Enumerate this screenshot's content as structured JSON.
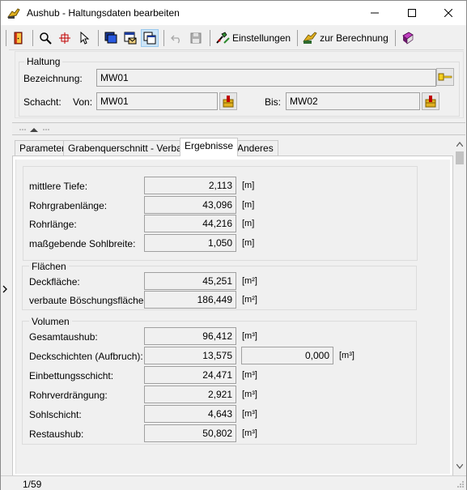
{
  "window": {
    "title": "Aushub - Haltungsdaten bearbeiten"
  },
  "toolbar": {
    "settings_label": "Einstellungen",
    "calculate_label": "zur Berechnung"
  },
  "haltung": {
    "group_title": "Haltung",
    "bezeichnung_label": "Bezeichnung:",
    "bezeichnung_value": "MW01",
    "schacht_label": "Schacht:",
    "von_label": "Von:",
    "von_value": "MW01",
    "bis_label": "Bis:",
    "bis_value": "MW02"
  },
  "tabs": [
    {
      "label": "Parameter"
    },
    {
      "label": "Grabenquerschnitt - Verbaut"
    },
    {
      "label": "Ergebnisse"
    },
    {
      "label": "Anderes"
    }
  ],
  "results": {
    "general": [
      {
        "label": "mittlere Tiefe:",
        "value": "2,113",
        "unit": "[m]"
      },
      {
        "label": "Rohrgrabenlänge:",
        "value": "43,096",
        "unit": "[m]"
      },
      {
        "label": "Rohrlänge:",
        "value": "44,216",
        "unit": "[m]"
      },
      {
        "label": "maßgebende Sohlbreite:",
        "value": "1,050",
        "unit": "[m]"
      }
    ],
    "flaechen": {
      "title": "Flächen",
      "rows": [
        {
          "label": "Deckfläche:",
          "value": "45,251",
          "unit": "[m²]"
        },
        {
          "label": "verbaute Böschungsfläche:",
          "value": "186,449",
          "unit": "[m²]"
        }
      ]
    },
    "volumen": {
      "title": "Volumen",
      "rows": [
        {
          "label": "Gesamtaushub:",
          "value": "96,412",
          "unit": "[m³]"
        },
        {
          "label": "Deckschichten (Aufbruch):",
          "value": "13,575",
          "unit": "",
          "extra_value": "0,000",
          "extra_unit": "[m³]"
        },
        {
          "label": "Einbettungsschicht:",
          "value": "24,471",
          "unit": "[m³]"
        },
        {
          "label": "Rohrverdrängung:",
          "value": "2,921",
          "unit": "[m³]"
        },
        {
          "label": "Sohlschicht:",
          "value": "4,643",
          "unit": "[m³]"
        },
        {
          "label": "Restaushub:",
          "value": "50,802",
          "unit": "[m³]"
        }
      ]
    }
  },
  "status": {
    "record": "1/59"
  },
  "colors": {
    "pressed_bg": "#cce4f7",
    "field_border": "#a0a0a0",
    "panel_bg": "#f0f0f0"
  }
}
